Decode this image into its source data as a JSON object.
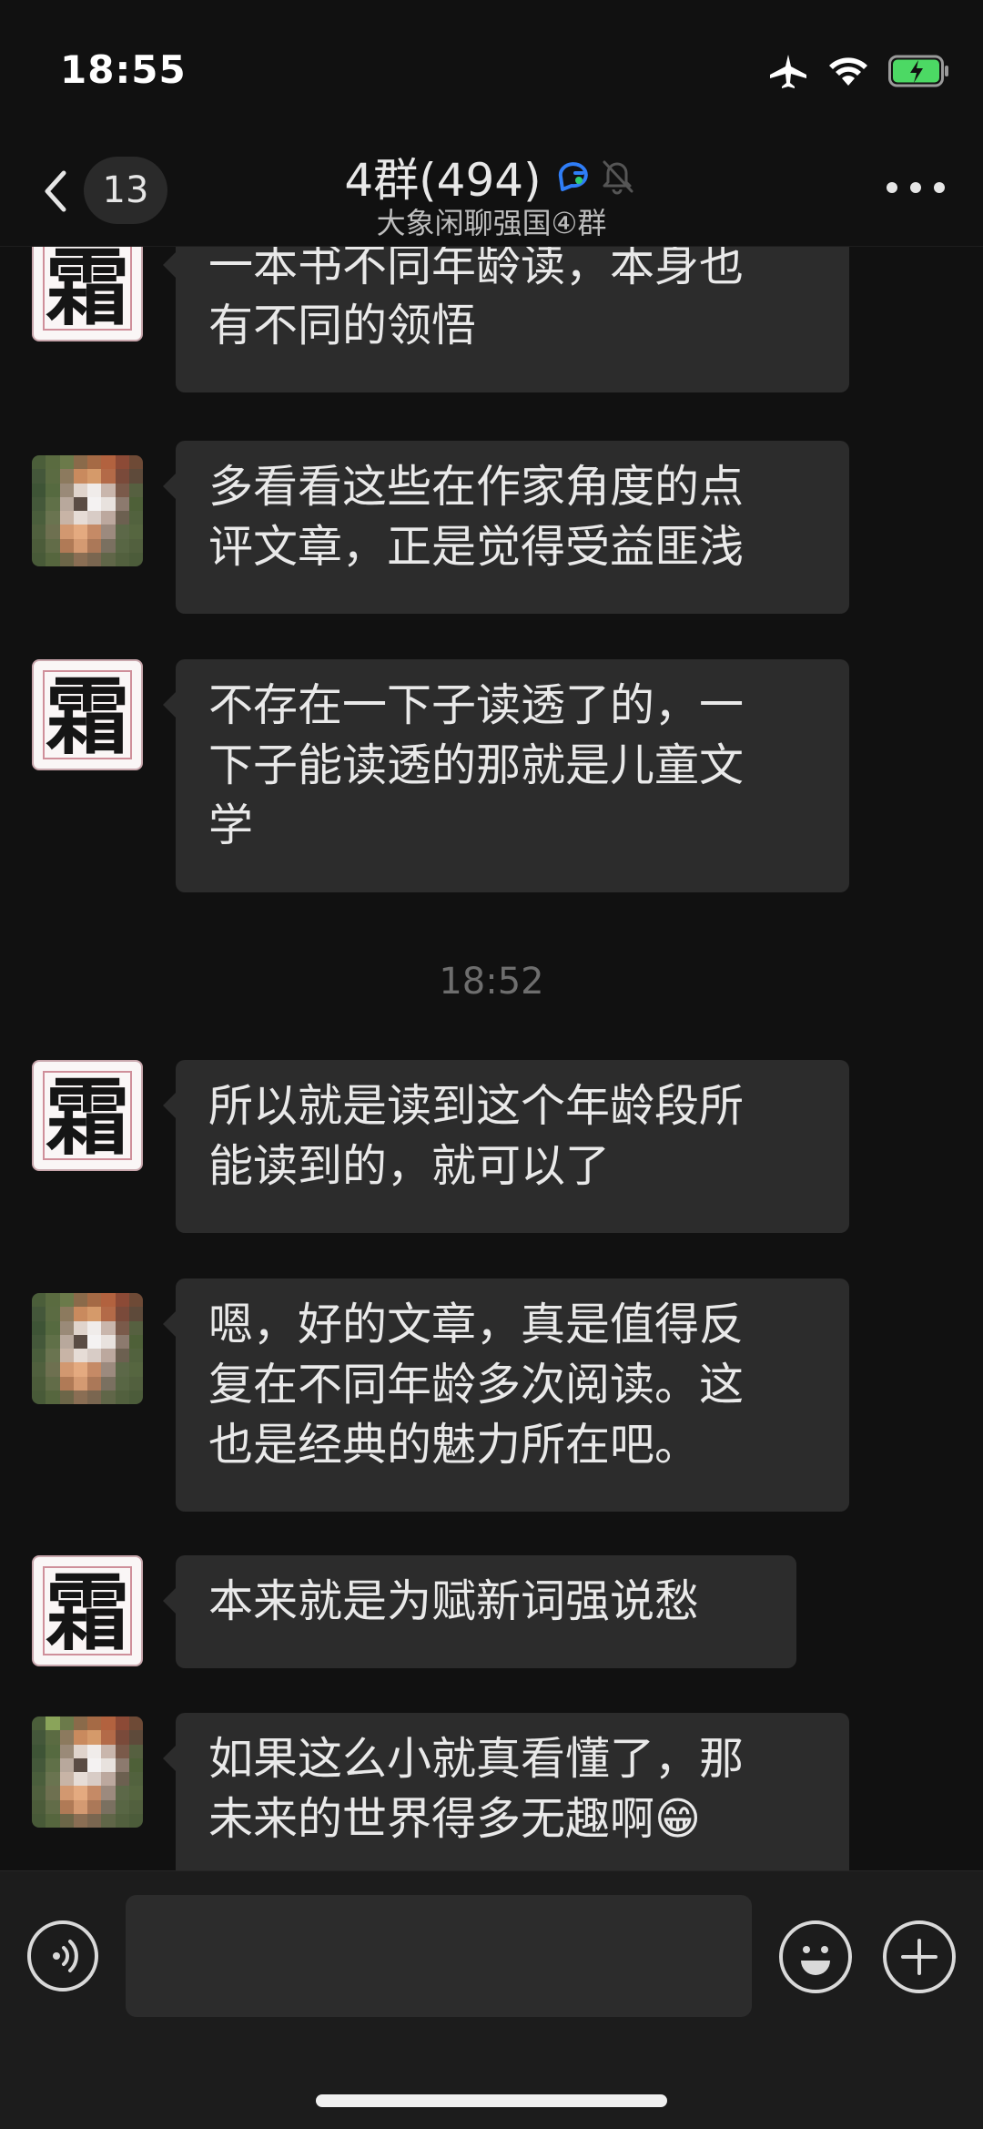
{
  "status_bar": {
    "time": "18:55",
    "icons": [
      "airplane-icon",
      "wifi-icon",
      "battery-charging-icon"
    ],
    "battery_color": "#4cd964"
  },
  "header": {
    "unread_count": "13",
    "title": "4群(494)",
    "subtitle": "大象闲聊强国④群",
    "icons": [
      "back-chevron-icon",
      "group-chat-icon",
      "mute-bell-icon",
      "more-icon"
    ]
  },
  "messages": [
    {
      "sender": "shuang",
      "avatar_char": "霜",
      "text": "一本书不同年龄读，本身也\n有不同的领悟"
    },
    {
      "sender": "pixel",
      "text": "多看看这些在作家角度的点\n评文章，正是觉得受益匪浅"
    },
    {
      "sender": "shuang",
      "avatar_char": "霜",
      "text": "不存在一下子读透了的，一\n下子能读透的那就是儿童文\n学"
    },
    {
      "sender": "shuang",
      "avatar_char": "霜",
      "text": "所以就是读到这个年龄段所\n能读到的，就可以了"
    },
    {
      "sender": "pixel",
      "text": "嗯，好的文章，真是值得反\n复在不同年龄多次阅读。这\n也是经典的魅力所在吧。"
    },
    {
      "sender": "shuang",
      "avatar_char": "霜",
      "text": "本来就是为赋新词强说愁"
    },
    {
      "sender": "pixel",
      "text": "如果这么小就真看懂了，那\n未来的世界得多无趣啊😁"
    }
  ],
  "timestamp_separator": "18:52",
  "input_bar": {
    "placeholder": "",
    "icons": [
      "voice-icon",
      "emoji-icon",
      "plus-icon"
    ]
  },
  "colors": {
    "background": "#111111",
    "bubble": "#2c2c2c",
    "text": "#e9e9e9",
    "accent_blue": "#2f7df6"
  }
}
